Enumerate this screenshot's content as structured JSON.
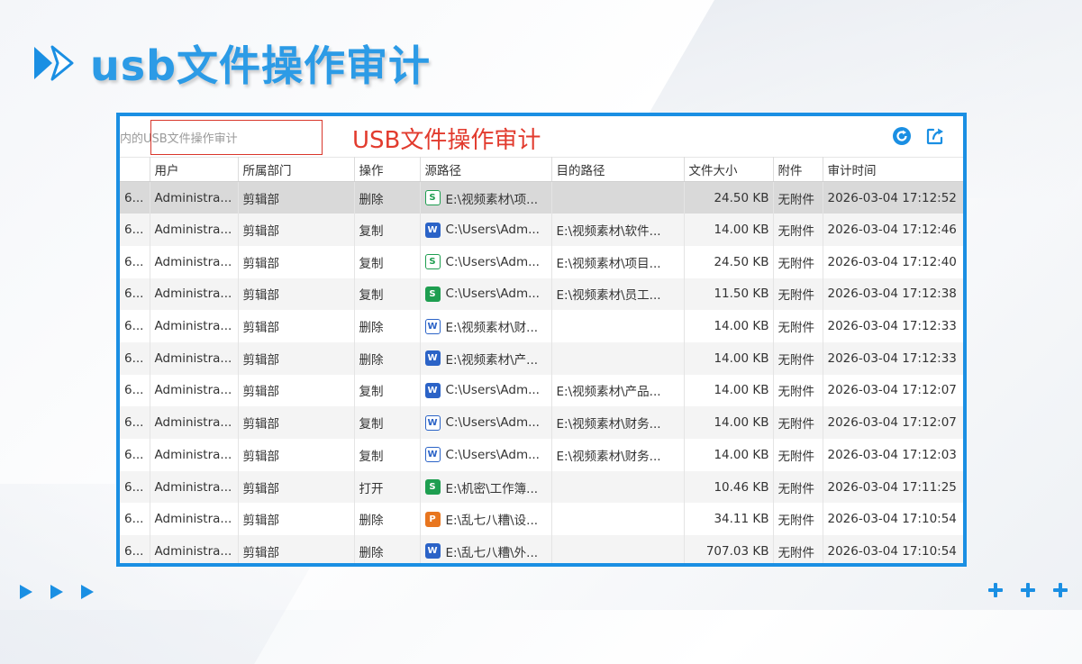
{
  "slide": {
    "title": "usb文件操作审计",
    "accent_color": "#2c9be6",
    "title_icon": "double-chevron-right-icon",
    "bottom_left_icons": [
      "play-icon",
      "play-icon",
      "play-icon"
    ],
    "bottom_right_icons": [
      "plus-icon",
      "plus-icon",
      "plus-icon"
    ]
  },
  "panel": {
    "border_color": "#1a8fe3",
    "search_text": "内的USB文件操作审计",
    "annotation": "USB文件操作审计",
    "annotation_color": "#e23b2e",
    "refresh_icon": "refresh-icon",
    "export_icon": "export-icon"
  },
  "table": {
    "columns": [
      "",
      "用户",
      "所属部门",
      "操作",
      "源路径",
      "目的路径",
      "文件大小",
      "附件",
      "审计时间"
    ],
    "rows": [
      {
        "id": "6...",
        "user": "Administra...",
        "dept": "剪辑部",
        "op": "删除",
        "icon": "s-o",
        "icon_name": "excel-file-icon",
        "src": "E:\\视频素材\\项...",
        "dst": "",
        "size": "24.50 KB",
        "attach": "无附件",
        "time": "2026-03-04 17:12:52",
        "selected": true
      },
      {
        "id": "6...",
        "user": "Administra...",
        "dept": "剪辑部",
        "op": "复制",
        "icon": "w",
        "icon_name": "word-file-icon",
        "src": "C:\\Users\\Adm...",
        "dst": "E:\\视频素材\\软件...",
        "size": "14.00 KB",
        "attach": "无附件",
        "time": "2026-03-04 17:12:46"
      },
      {
        "id": "6...",
        "user": "Administra...",
        "dept": "剪辑部",
        "op": "复制",
        "icon": "s-o",
        "icon_name": "excel-file-icon",
        "src": "C:\\Users\\Adm...",
        "dst": "E:\\视频素材\\项目...",
        "size": "24.50 KB",
        "attach": "无附件",
        "time": "2026-03-04 17:12:40"
      },
      {
        "id": "6...",
        "user": "Administra...",
        "dept": "剪辑部",
        "op": "复制",
        "icon": "s",
        "icon_name": "excel-file-icon",
        "src": "C:\\Users\\Adm...",
        "dst": "E:\\视频素材\\员工...",
        "size": "11.50 KB",
        "attach": "无附件",
        "time": "2026-03-04 17:12:38"
      },
      {
        "id": "6...",
        "user": "Administra...",
        "dept": "剪辑部",
        "op": "删除",
        "icon": "w-o",
        "icon_name": "word-file-icon",
        "src": "E:\\视频素材\\财...",
        "dst": "",
        "size": "14.00 KB",
        "attach": "无附件",
        "time": "2026-03-04 17:12:33"
      },
      {
        "id": "6...",
        "user": "Administra...",
        "dept": "剪辑部",
        "op": "删除",
        "icon": "w",
        "icon_name": "word-file-icon",
        "src": "E:\\视频素材\\产...",
        "dst": "",
        "size": "14.00 KB",
        "attach": "无附件",
        "time": "2026-03-04 17:12:33"
      },
      {
        "id": "6...",
        "user": "Administra...",
        "dept": "剪辑部",
        "op": "复制",
        "icon": "w",
        "icon_name": "word-file-icon",
        "src": "C:\\Users\\Adm...",
        "dst": "E:\\视频素材\\产品...",
        "size": "14.00 KB",
        "attach": "无附件",
        "time": "2026-03-04 17:12:07"
      },
      {
        "id": "6...",
        "user": "Administra...",
        "dept": "剪辑部",
        "op": "复制",
        "icon": "w-o",
        "icon_name": "word-file-icon",
        "src": "C:\\Users\\Adm...",
        "dst": "E:\\视频素材\\财务...",
        "size": "14.00 KB",
        "attach": "无附件",
        "time": "2026-03-04 17:12:07"
      },
      {
        "id": "6...",
        "user": "Administra...",
        "dept": "剪辑部",
        "op": "复制",
        "icon": "w-o",
        "icon_name": "word-file-icon",
        "src": "C:\\Users\\Adm...",
        "dst": "E:\\视频素材\\财务...",
        "size": "14.00 KB",
        "attach": "无附件",
        "time": "2026-03-04 17:12:03"
      },
      {
        "id": "6...",
        "user": "Administra...",
        "dept": "剪辑部",
        "op": "打开",
        "icon": "s",
        "icon_name": "excel-file-icon",
        "src": "E:\\机密\\工作簿...",
        "dst": "",
        "size": "10.46 KB",
        "attach": "无附件",
        "time": "2026-03-04 17:11:25"
      },
      {
        "id": "6...",
        "user": "Administra...",
        "dept": "剪辑部",
        "op": "删除",
        "icon": "p",
        "icon_name": "ppt-file-icon",
        "src": "E:\\乱七八糟\\设...",
        "dst": "",
        "size": "34.11 KB",
        "attach": "无附件",
        "time": "2026-03-04 17:10:54"
      },
      {
        "id": "6...",
        "user": "Administra...",
        "dept": "剪辑部",
        "op": "删除",
        "icon": "w",
        "icon_name": "word-file-icon",
        "src": "E:\\乱七八糟\\外...",
        "dst": "",
        "size": "707.03 KB",
        "attach": "无附件",
        "time": "2026-03-04 17:10:54"
      }
    ]
  }
}
